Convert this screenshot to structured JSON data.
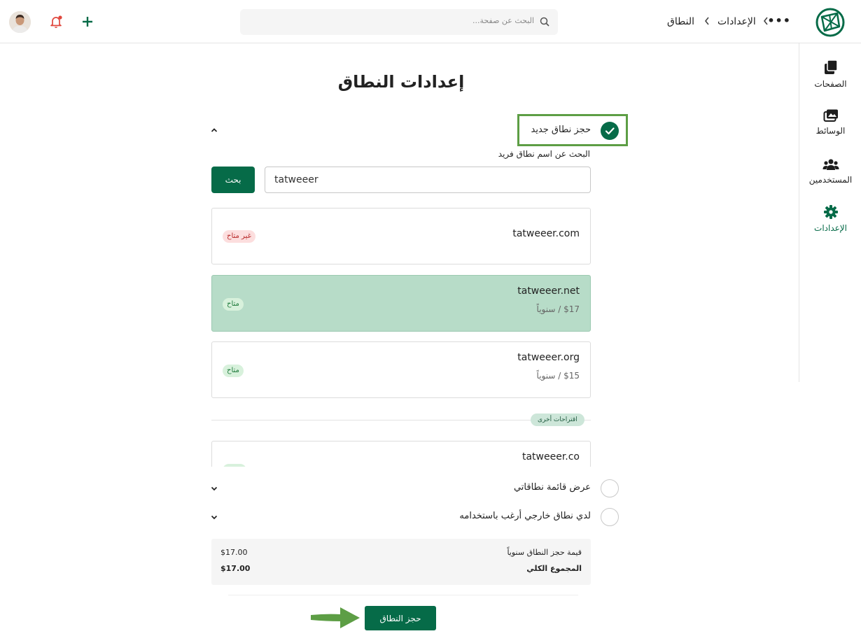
{
  "header": {
    "breadcrumb": [
      "الإعدادات",
      "النطاق"
    ],
    "search_placeholder": "البحث عن صفحة..."
  },
  "sidebar": {
    "items": [
      {
        "label": "الصفحات",
        "icon": "pages-icon"
      },
      {
        "label": "الوسائط",
        "icon": "media-icon"
      },
      {
        "label": "المستخدمين",
        "icon": "users-icon"
      },
      {
        "label": "الإعدادات",
        "icon": "settings-gear-icon",
        "active": true
      }
    ]
  },
  "page": {
    "title": "إعدادات النطاق"
  },
  "options": {
    "new_domain": "حجز نطاق جديد",
    "my_domains": "عرض قائمة نطاقاتي",
    "external_domain": "لدي نطاق خارجي أرغب باستخدامه"
  },
  "search": {
    "hint": "البحث عن اسم نطاق فريد",
    "value": "tatweeer",
    "button": "بحث"
  },
  "results": [
    {
      "domain": "tatweeer.com",
      "status": "غير متاح"
    },
    {
      "domain": "tatweeer.net",
      "price": "$17 / سنوياً",
      "status": "متاح",
      "selected": true
    },
    {
      "domain": "tatweeer.org",
      "price": "$15 / سنوياً",
      "status": "متاح"
    }
  ],
  "suggestions": {
    "label": "اقتراحات أخرى",
    "items": [
      {
        "domain": "tatweeer.co"
      }
    ]
  },
  "summary": {
    "price_label": "قيمة حجز النطاق سنوياً",
    "price_value": "$17.00",
    "total_label": "المجموع الكلي",
    "total_value": "$17.00"
  },
  "cta": {
    "book_label": "حجز النطاق"
  },
  "colors": {
    "primary": "#066b48",
    "selected_bg": "#b7dcc8",
    "highlight_border": "#5d9e45",
    "unavailable": "#b92b2b",
    "available": "#1f7a3b"
  }
}
